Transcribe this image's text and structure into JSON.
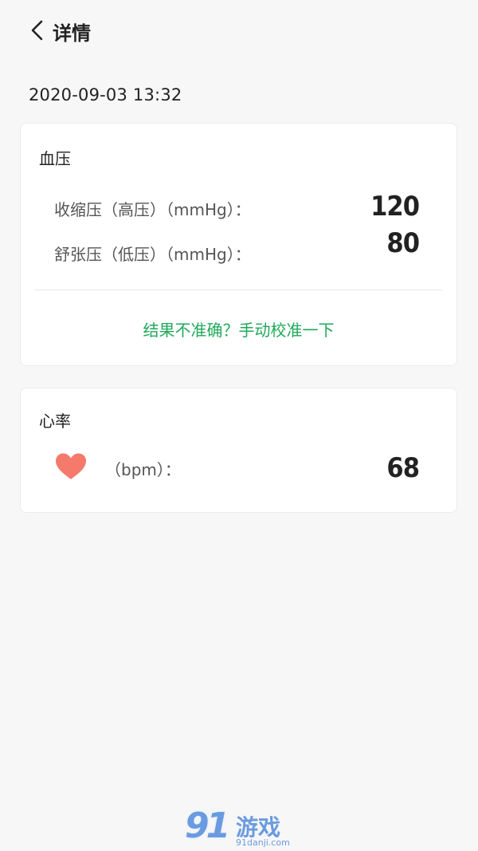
{
  "header": {
    "title": "详情",
    "back_icon": "chevron-left-icon"
  },
  "record": {
    "datetime": "2020-09-03  13:32"
  },
  "blood_pressure": {
    "title": "血压",
    "systolic_label": "收缩压（高压）（mmHg）：",
    "systolic_value": "120",
    "diastolic_label": "舒张压（低压）（mmHg）：",
    "diastolic_value": "80",
    "calibrate_link": "结果不准确？手动校准一下",
    "link_color": "#20a95a"
  },
  "heart_rate": {
    "title": "心率",
    "icon": "heart-icon",
    "heart_color": "#f57a6b",
    "label": "（bpm）：",
    "value": "68"
  },
  "watermark": {
    "number": "91",
    "text": "游戏",
    "sub": "91danji.com"
  }
}
